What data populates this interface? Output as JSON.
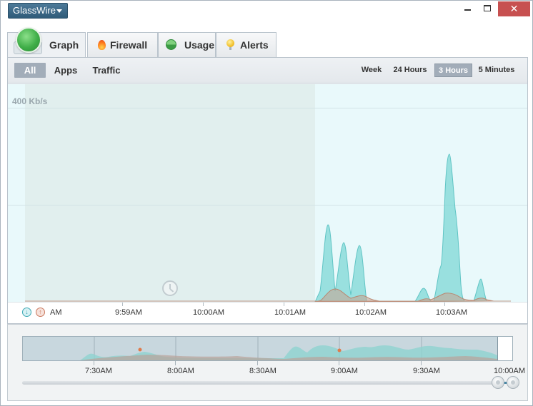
{
  "app": {
    "menu_label": "GlassWire",
    "window_controls": {
      "minimize": "minimize",
      "maximize": "maximize",
      "close": "✕"
    }
  },
  "tabs": [
    {
      "label": "Graph",
      "icon": "globe-icon",
      "active": true
    },
    {
      "label": "Firewall",
      "icon": "flame-icon",
      "active": false
    },
    {
      "label": "Usage",
      "icon": "pie-chart-icon",
      "active": false
    },
    {
      "label": "Alerts",
      "icon": "bell-icon",
      "active": false
    }
  ],
  "filters": [
    {
      "label": "All",
      "selected": true
    },
    {
      "label": "Apps",
      "selected": false
    },
    {
      "label": "Traffic",
      "selected": false
    }
  ],
  "time_ranges": [
    {
      "label": "Week",
      "selected": false
    },
    {
      "label": "24 Hours",
      "selected": false
    },
    {
      "label": "3 Hours",
      "selected": true
    },
    {
      "label": "5 Minutes",
      "selected": false
    }
  ],
  "graph": {
    "y_label": "400 Kb/s",
    "axis_labels": [
      "AM",
      "9:59AM",
      "10:00AM",
      "10:01AM",
      "10:02AM",
      "10:03AM"
    ],
    "download_icon": "↓",
    "upload_icon": "↑",
    "colors": {
      "download": "#7ed7d6",
      "upload": "#d8a08c"
    }
  },
  "timeline": {
    "labels": [
      "7:30AM",
      "8:00AM",
      "8:30AM",
      "9:00AM",
      "9:30AM",
      "10:00AM"
    ]
  }
}
